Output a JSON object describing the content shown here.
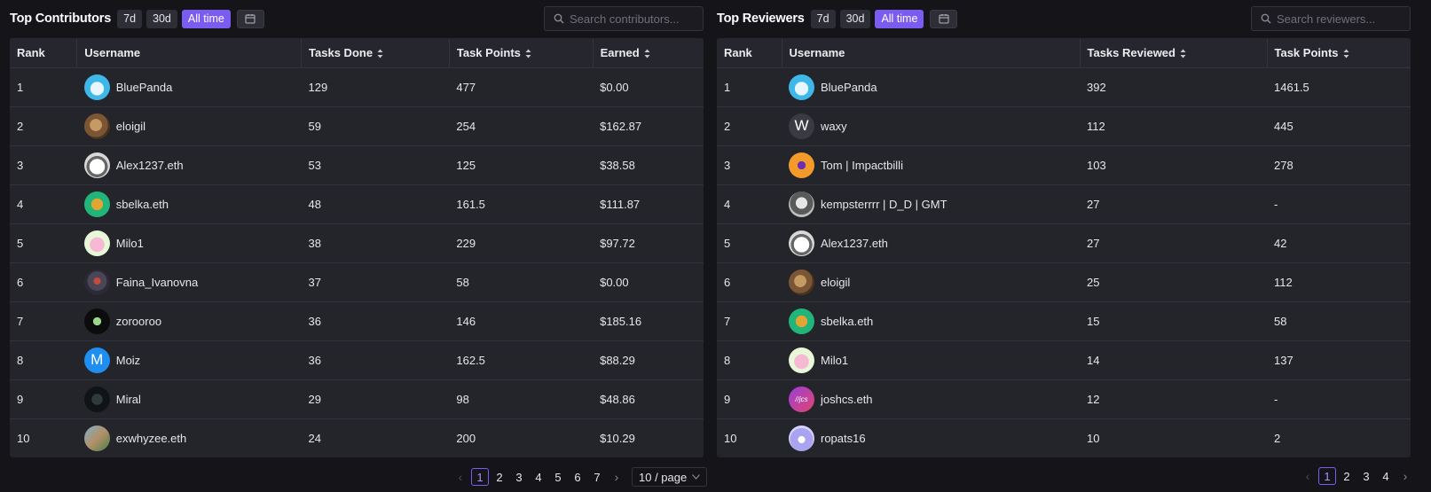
{
  "contributors": {
    "title": "Top Contributors",
    "ranges": [
      {
        "label": "7d",
        "active": false
      },
      {
        "label": "30d",
        "active": false
      },
      {
        "label": "All time",
        "active": true
      }
    ],
    "search_placeholder": "Search contributors...",
    "columns": [
      "Rank",
      "Username",
      "Tasks Done",
      "Task Points",
      "Earned"
    ],
    "rows": [
      {
        "rank": "1",
        "username": "BluePanda",
        "tasks": "129",
        "points": "477",
        "earned": "$0.00",
        "avatar": "panda"
      },
      {
        "rank": "2",
        "username": "eloigil",
        "tasks": "59",
        "points": "254",
        "earned": "$162.87",
        "avatar": "dog"
      },
      {
        "rank": "3",
        "username": "Alex1237.eth",
        "tasks": "53",
        "points": "125",
        "earned": "$38.58",
        "avatar": "cat"
      },
      {
        "rank": "4",
        "username": "sbelka.eth",
        "tasks": "48",
        "points": "161.5",
        "earned": "$111.87",
        "avatar": "squirrel"
      },
      {
        "rank": "5",
        "username": "Milo1",
        "tasks": "38",
        "points": "229",
        "earned": "$97.72",
        "avatar": "pig"
      },
      {
        "rank": "6",
        "username": "Faina_Ivanovna",
        "tasks": "37",
        "points": "58",
        "earned": "$0.00",
        "avatar": "robot"
      },
      {
        "rank": "7",
        "username": "zorooroo",
        "tasks": "36",
        "points": "146",
        "earned": "$185.16",
        "avatar": "alien"
      },
      {
        "rank": "8",
        "username": "Moiz",
        "tasks": "36",
        "points": "162.5",
        "earned": "$88.29",
        "avatar": "letter",
        "initial": "M"
      },
      {
        "rank": "9",
        "username": "Miral",
        "tasks": "29",
        "points": "98",
        "earned": "$48.86",
        "avatar": "dark"
      },
      {
        "rank": "10",
        "username": "exwhyzee.eth",
        "tasks": "24",
        "points": "200",
        "earned": "$10.29",
        "avatar": "photo"
      }
    ],
    "pagination": {
      "pages": [
        "1",
        "2",
        "3",
        "4",
        "5",
        "6",
        "7"
      ],
      "current": "1",
      "page_size": "10 / page"
    }
  },
  "reviewers": {
    "title": "Top Reviewers",
    "ranges": [
      {
        "label": "7d",
        "active": false
      },
      {
        "label": "30d",
        "active": false
      },
      {
        "label": "All time",
        "active": true
      }
    ],
    "search_placeholder": "Search reviewers...",
    "columns": [
      "Rank",
      "Username",
      "Tasks Reviewed",
      "Task Points"
    ],
    "rows": [
      {
        "rank": "1",
        "username": "BluePanda",
        "reviewed": "392",
        "points": "1461.5",
        "avatar": "panda"
      },
      {
        "rank": "2",
        "username": "waxy",
        "reviewed": "112",
        "points": "445",
        "avatar": "letter-dark",
        "initial": "W"
      },
      {
        "rank": "3",
        "username": "Tom | Impactbilli",
        "reviewed": "103",
        "points": "278",
        "avatar": "orange"
      },
      {
        "rank": "4",
        "username": "kempsterrrr | D_D | GMT",
        "reviewed": "27",
        "points": "-",
        "avatar": "bw"
      },
      {
        "rank": "5",
        "username": "Alex1237.eth",
        "reviewed": "27",
        "points": "42",
        "avatar": "cat"
      },
      {
        "rank": "6",
        "username": "eloigil",
        "reviewed": "25",
        "points": "112",
        "avatar": "dog"
      },
      {
        "rank": "7",
        "username": "sbelka.eth",
        "reviewed": "15",
        "points": "58",
        "avatar": "squirrel"
      },
      {
        "rank": "8",
        "username": "Milo1",
        "reviewed": "14",
        "points": "137",
        "avatar": "pig"
      },
      {
        "rank": "9",
        "username": "joshcs.eth",
        "reviewed": "12",
        "points": "-",
        "avatar": "gradient",
        "initial": "//jcs"
      },
      {
        "rank": "10",
        "username": "ropats16",
        "reviewed": "10",
        "points": "2",
        "avatar": "lilac"
      }
    ],
    "pagination": {
      "pages": [
        "1",
        "2",
        "3",
        "4"
      ],
      "current": "1"
    }
  },
  "colors": {
    "accent": "#7b5cf0",
    "background": "#141419",
    "table_bg": "#24242b"
  }
}
